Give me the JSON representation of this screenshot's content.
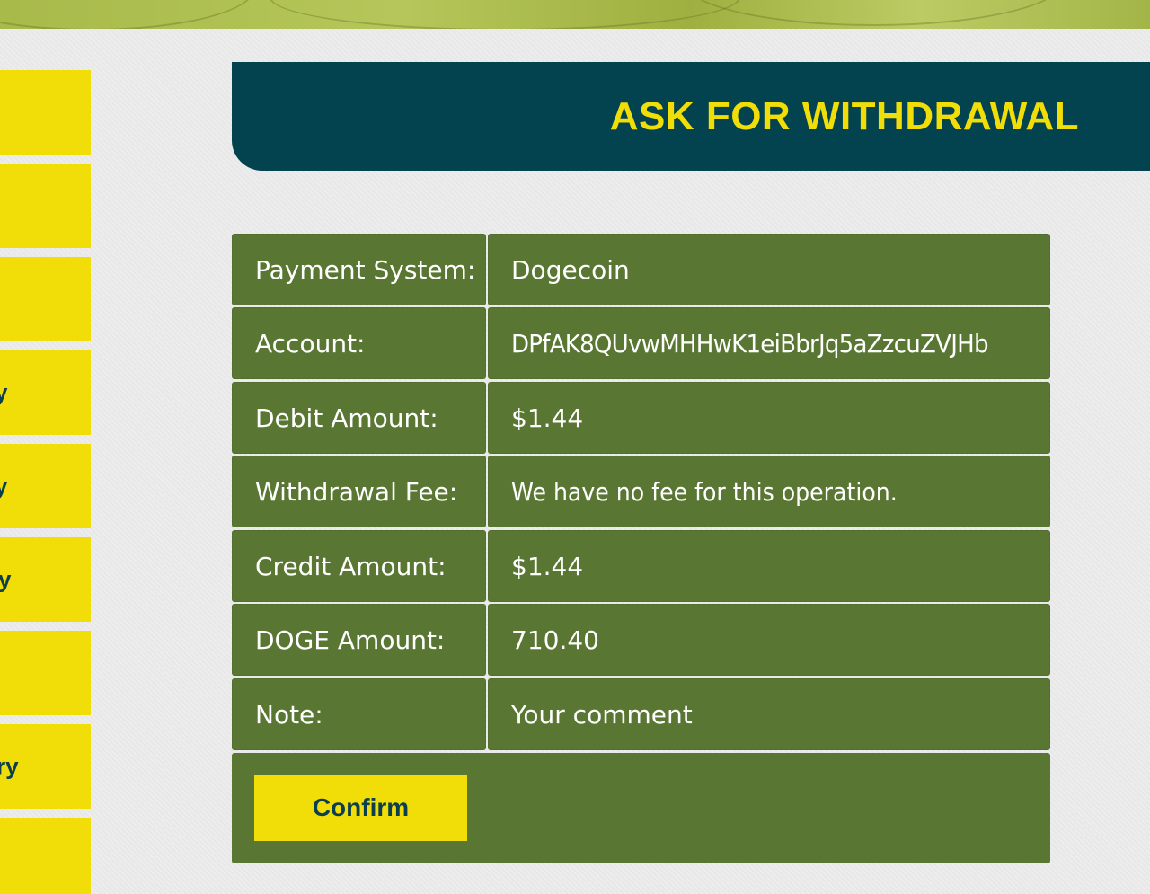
{
  "header": {
    "title": "ASK FOR WITHDRAWAL"
  },
  "sidebar": {
    "items": [
      {
        "label": ""
      },
      {
        "label": ""
      },
      {
        "label": ""
      },
      {
        "label": "y"
      },
      {
        "label": "y"
      },
      {
        "label": "y"
      },
      {
        "label": ""
      },
      {
        "label": "ry"
      },
      {
        "label": ""
      }
    ]
  },
  "form": {
    "rows": [
      {
        "label": "Payment System:",
        "value": "Dogecoin"
      },
      {
        "label": "Account:",
        "value": "DPfAK8QUvwMHHwK1eiBbrJq5aZzcuZVJHb"
      },
      {
        "label": "Debit Amount:",
        "value": "$1.44"
      },
      {
        "label": "Withdrawal Fee:",
        "value": "We have no fee for this operation."
      },
      {
        "label": "Credit Amount:",
        "value": "$1.44"
      },
      {
        "label": "DOGE Amount:",
        "value": "710.40"
      },
      {
        "label": "Note:",
        "value": "Your comment"
      }
    ],
    "confirm_label": "Confirm"
  },
  "colors": {
    "accent_yellow": "#f1dd08",
    "header_teal": "#02434f",
    "row_green": "#597633",
    "banner_green": "#a8ba4a"
  }
}
